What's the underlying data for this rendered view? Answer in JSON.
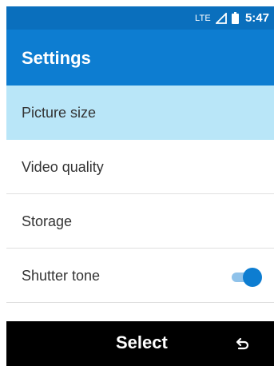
{
  "status_bar": {
    "network": "LTE",
    "signal_icon": "signal-strength-icon",
    "battery_icon": "battery-icon",
    "time": "5:47"
  },
  "app_bar": {
    "title": "Settings"
  },
  "settings": {
    "items": [
      {
        "label": "Picture size",
        "selected": true
      },
      {
        "label": "Video quality",
        "selected": false
      },
      {
        "label": "Storage",
        "selected": false
      },
      {
        "label": "Shutter tone",
        "selected": false,
        "toggle": true,
        "toggle_on": true
      }
    ]
  },
  "softkeys": {
    "center_label": "Select",
    "right_icon": "back-icon"
  },
  "colors": {
    "status_bar": "#0a6fbd",
    "app_bar": "#0d7dd1",
    "selected_row": "#b9e6f8",
    "toggle_thumb": "#0d7dd1",
    "toggle_track": "#8fc2ea",
    "softkey_bar": "#000000"
  }
}
